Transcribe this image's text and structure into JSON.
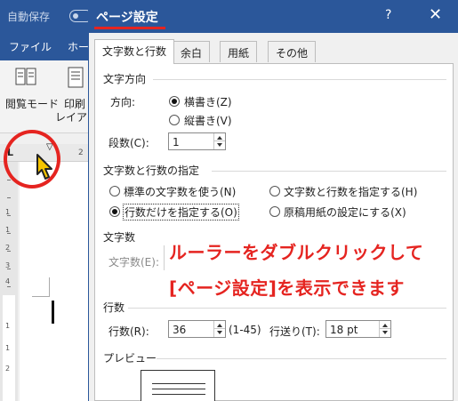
{
  "word": {
    "autosave_label": "自動保存",
    "tab_file": "ファイル",
    "tab_home": "ホー",
    "read_mode": "閲覧モード",
    "print_layout_1": "印刷",
    "print_layout_2": "レイアウ",
    "ruler_h_num": "2",
    "ruler_v_nums": [
      "1",
      "1",
      "2",
      "3",
      "4",
      "1",
      "1",
      "2"
    ]
  },
  "dialog": {
    "title": "ページ設定",
    "help": "?",
    "close": "✕",
    "tabs": [
      "文字数と行数",
      "余白",
      "用紙",
      "その他"
    ],
    "active_tab": 0,
    "direction": {
      "group": "文字方向",
      "label": "方向:",
      "horizontal": "横書き(Z)",
      "vertical": "縦書き(V)",
      "selected": "horizontal",
      "columns_label": "段数(C):",
      "columns_value": "1"
    },
    "grid": {
      "group": "文字数と行数の指定",
      "options": [
        "標準の文字数を使う(N)",
        "文字数と行数を指定する(H)",
        "行数だけを指定する(O)",
        "原稿用紙の設定にする(X)"
      ],
      "selected_index": 2
    },
    "chars": {
      "group": "文字数",
      "chars_label": "文字数(E):"
    },
    "lines": {
      "group": "行数",
      "lines_label": "行数(R):",
      "lines_value": "36",
      "lines_range": "(1-45)",
      "pitch_label": "行送り(T):",
      "pitch_value": "18 pt"
    },
    "preview_label": "プレビュー"
  },
  "annotation": {
    "line1": "ルーラーをダブルクリックして",
    "line2": "[ページ設定]を表示できます"
  },
  "colors": {
    "word_blue": "#2b579a",
    "annotation_red": "#e52420"
  }
}
